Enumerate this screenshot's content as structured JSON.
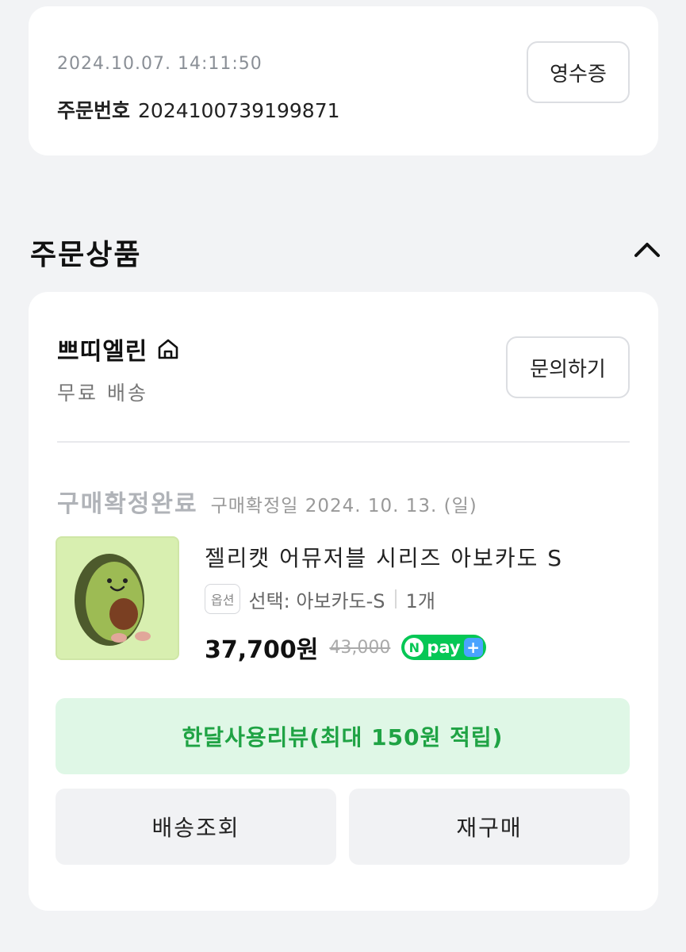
{
  "order": {
    "datetime": "2024.10.07. 14:11:50",
    "number_label": "주문번호",
    "number": "2024100739199871",
    "receipt_label": "영수증"
  },
  "section": {
    "title": "주문상품",
    "toggle_icon": "chevron-up-icon"
  },
  "seller": {
    "name": "쁘띠엘린",
    "store_icon": "home-icon",
    "shipping": "무료 배송",
    "inquiry_label": "문의하기"
  },
  "item": {
    "status": "구매확정완료",
    "confirm_date": "구매확정일 2024. 10. 13. (일)",
    "name": "젤리캣 어뮤저블 시리즈 아보카도 S",
    "option_badge": "옵션",
    "option": "선택: 아보카도-S",
    "quantity": "1개",
    "price": "37,700원",
    "original_price": "43,000",
    "npay_n": "N",
    "npay_text": "pay",
    "npay_plus": "+"
  },
  "actions": {
    "review": "한달사용리뷰(최대 150원 적립)",
    "track": "배송조회",
    "rebuy": "재구매"
  },
  "colors": {
    "accent_green": "#1fa344",
    "review_bg": "#dff7e6",
    "npay_green": "#06c755"
  }
}
